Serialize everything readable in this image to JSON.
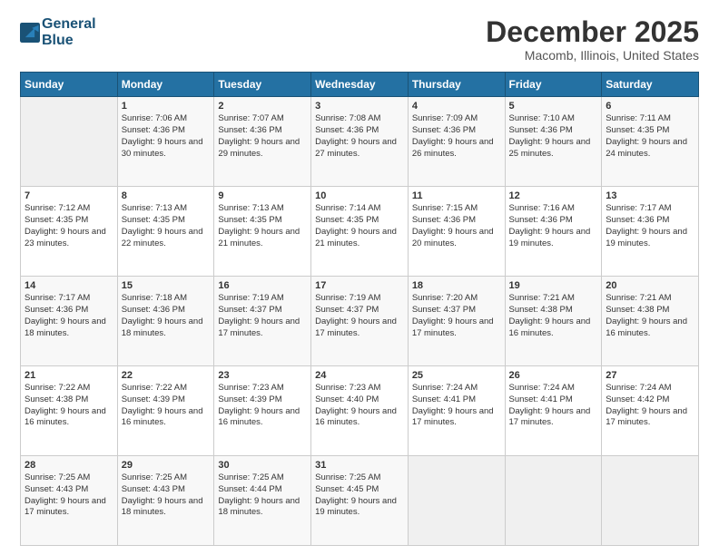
{
  "header": {
    "logo_line1": "General",
    "logo_line2": "Blue",
    "month": "December 2025",
    "location": "Macomb, Illinois, United States"
  },
  "weekdays": [
    "Sunday",
    "Monday",
    "Tuesday",
    "Wednesday",
    "Thursday",
    "Friday",
    "Saturday"
  ],
  "weeks": [
    [
      {
        "day": "",
        "empty": true
      },
      {
        "day": "1",
        "sunrise": "Sunrise: 7:06 AM",
        "sunset": "Sunset: 4:36 PM",
        "daylight": "Daylight: 9 hours and 30 minutes."
      },
      {
        "day": "2",
        "sunrise": "Sunrise: 7:07 AM",
        "sunset": "Sunset: 4:36 PM",
        "daylight": "Daylight: 9 hours and 29 minutes."
      },
      {
        "day": "3",
        "sunrise": "Sunrise: 7:08 AM",
        "sunset": "Sunset: 4:36 PM",
        "daylight": "Daylight: 9 hours and 27 minutes."
      },
      {
        "day": "4",
        "sunrise": "Sunrise: 7:09 AM",
        "sunset": "Sunset: 4:36 PM",
        "daylight": "Daylight: 9 hours and 26 minutes."
      },
      {
        "day": "5",
        "sunrise": "Sunrise: 7:10 AM",
        "sunset": "Sunset: 4:36 PM",
        "daylight": "Daylight: 9 hours and 25 minutes."
      },
      {
        "day": "6",
        "sunrise": "Sunrise: 7:11 AM",
        "sunset": "Sunset: 4:35 PM",
        "daylight": "Daylight: 9 hours and 24 minutes."
      }
    ],
    [
      {
        "day": "7",
        "sunrise": "Sunrise: 7:12 AM",
        "sunset": "Sunset: 4:35 PM",
        "daylight": "Daylight: 9 hours and 23 minutes."
      },
      {
        "day": "8",
        "sunrise": "Sunrise: 7:13 AM",
        "sunset": "Sunset: 4:35 PM",
        "daylight": "Daylight: 9 hours and 22 minutes."
      },
      {
        "day": "9",
        "sunrise": "Sunrise: 7:13 AM",
        "sunset": "Sunset: 4:35 PM",
        "daylight": "Daylight: 9 hours and 21 minutes."
      },
      {
        "day": "10",
        "sunrise": "Sunrise: 7:14 AM",
        "sunset": "Sunset: 4:35 PM",
        "daylight": "Daylight: 9 hours and 21 minutes."
      },
      {
        "day": "11",
        "sunrise": "Sunrise: 7:15 AM",
        "sunset": "Sunset: 4:36 PM",
        "daylight": "Daylight: 9 hours and 20 minutes."
      },
      {
        "day": "12",
        "sunrise": "Sunrise: 7:16 AM",
        "sunset": "Sunset: 4:36 PM",
        "daylight": "Daylight: 9 hours and 19 minutes."
      },
      {
        "day": "13",
        "sunrise": "Sunrise: 7:17 AM",
        "sunset": "Sunset: 4:36 PM",
        "daylight": "Daylight: 9 hours and 19 minutes."
      }
    ],
    [
      {
        "day": "14",
        "sunrise": "Sunrise: 7:17 AM",
        "sunset": "Sunset: 4:36 PM",
        "daylight": "Daylight: 9 hours and 18 minutes."
      },
      {
        "day": "15",
        "sunrise": "Sunrise: 7:18 AM",
        "sunset": "Sunset: 4:36 PM",
        "daylight": "Daylight: 9 hours and 18 minutes."
      },
      {
        "day": "16",
        "sunrise": "Sunrise: 7:19 AM",
        "sunset": "Sunset: 4:37 PM",
        "daylight": "Daylight: 9 hours and 17 minutes."
      },
      {
        "day": "17",
        "sunrise": "Sunrise: 7:19 AM",
        "sunset": "Sunset: 4:37 PM",
        "daylight": "Daylight: 9 hours and 17 minutes."
      },
      {
        "day": "18",
        "sunrise": "Sunrise: 7:20 AM",
        "sunset": "Sunset: 4:37 PM",
        "daylight": "Daylight: 9 hours and 17 minutes."
      },
      {
        "day": "19",
        "sunrise": "Sunrise: 7:21 AM",
        "sunset": "Sunset: 4:38 PM",
        "daylight": "Daylight: 9 hours and 16 minutes."
      },
      {
        "day": "20",
        "sunrise": "Sunrise: 7:21 AM",
        "sunset": "Sunset: 4:38 PM",
        "daylight": "Daylight: 9 hours and 16 minutes."
      }
    ],
    [
      {
        "day": "21",
        "sunrise": "Sunrise: 7:22 AM",
        "sunset": "Sunset: 4:38 PM",
        "daylight": "Daylight: 9 hours and 16 minutes."
      },
      {
        "day": "22",
        "sunrise": "Sunrise: 7:22 AM",
        "sunset": "Sunset: 4:39 PM",
        "daylight": "Daylight: 9 hours and 16 minutes."
      },
      {
        "day": "23",
        "sunrise": "Sunrise: 7:23 AM",
        "sunset": "Sunset: 4:39 PM",
        "daylight": "Daylight: 9 hours and 16 minutes."
      },
      {
        "day": "24",
        "sunrise": "Sunrise: 7:23 AM",
        "sunset": "Sunset: 4:40 PM",
        "daylight": "Daylight: 9 hours and 16 minutes."
      },
      {
        "day": "25",
        "sunrise": "Sunrise: 7:24 AM",
        "sunset": "Sunset: 4:41 PM",
        "daylight": "Daylight: 9 hours and 17 minutes."
      },
      {
        "day": "26",
        "sunrise": "Sunrise: 7:24 AM",
        "sunset": "Sunset: 4:41 PM",
        "daylight": "Daylight: 9 hours and 17 minutes."
      },
      {
        "day": "27",
        "sunrise": "Sunrise: 7:24 AM",
        "sunset": "Sunset: 4:42 PM",
        "daylight": "Daylight: 9 hours and 17 minutes."
      }
    ],
    [
      {
        "day": "28",
        "sunrise": "Sunrise: 7:25 AM",
        "sunset": "Sunset: 4:43 PM",
        "daylight": "Daylight: 9 hours and 17 minutes."
      },
      {
        "day": "29",
        "sunrise": "Sunrise: 7:25 AM",
        "sunset": "Sunset: 4:43 PM",
        "daylight": "Daylight: 9 hours and 18 minutes."
      },
      {
        "day": "30",
        "sunrise": "Sunrise: 7:25 AM",
        "sunset": "Sunset: 4:44 PM",
        "daylight": "Daylight: 9 hours and 18 minutes."
      },
      {
        "day": "31",
        "sunrise": "Sunrise: 7:25 AM",
        "sunset": "Sunset: 4:45 PM",
        "daylight": "Daylight: 9 hours and 19 minutes."
      },
      {
        "day": "",
        "empty": true
      },
      {
        "day": "",
        "empty": true
      },
      {
        "day": "",
        "empty": true
      }
    ]
  ]
}
